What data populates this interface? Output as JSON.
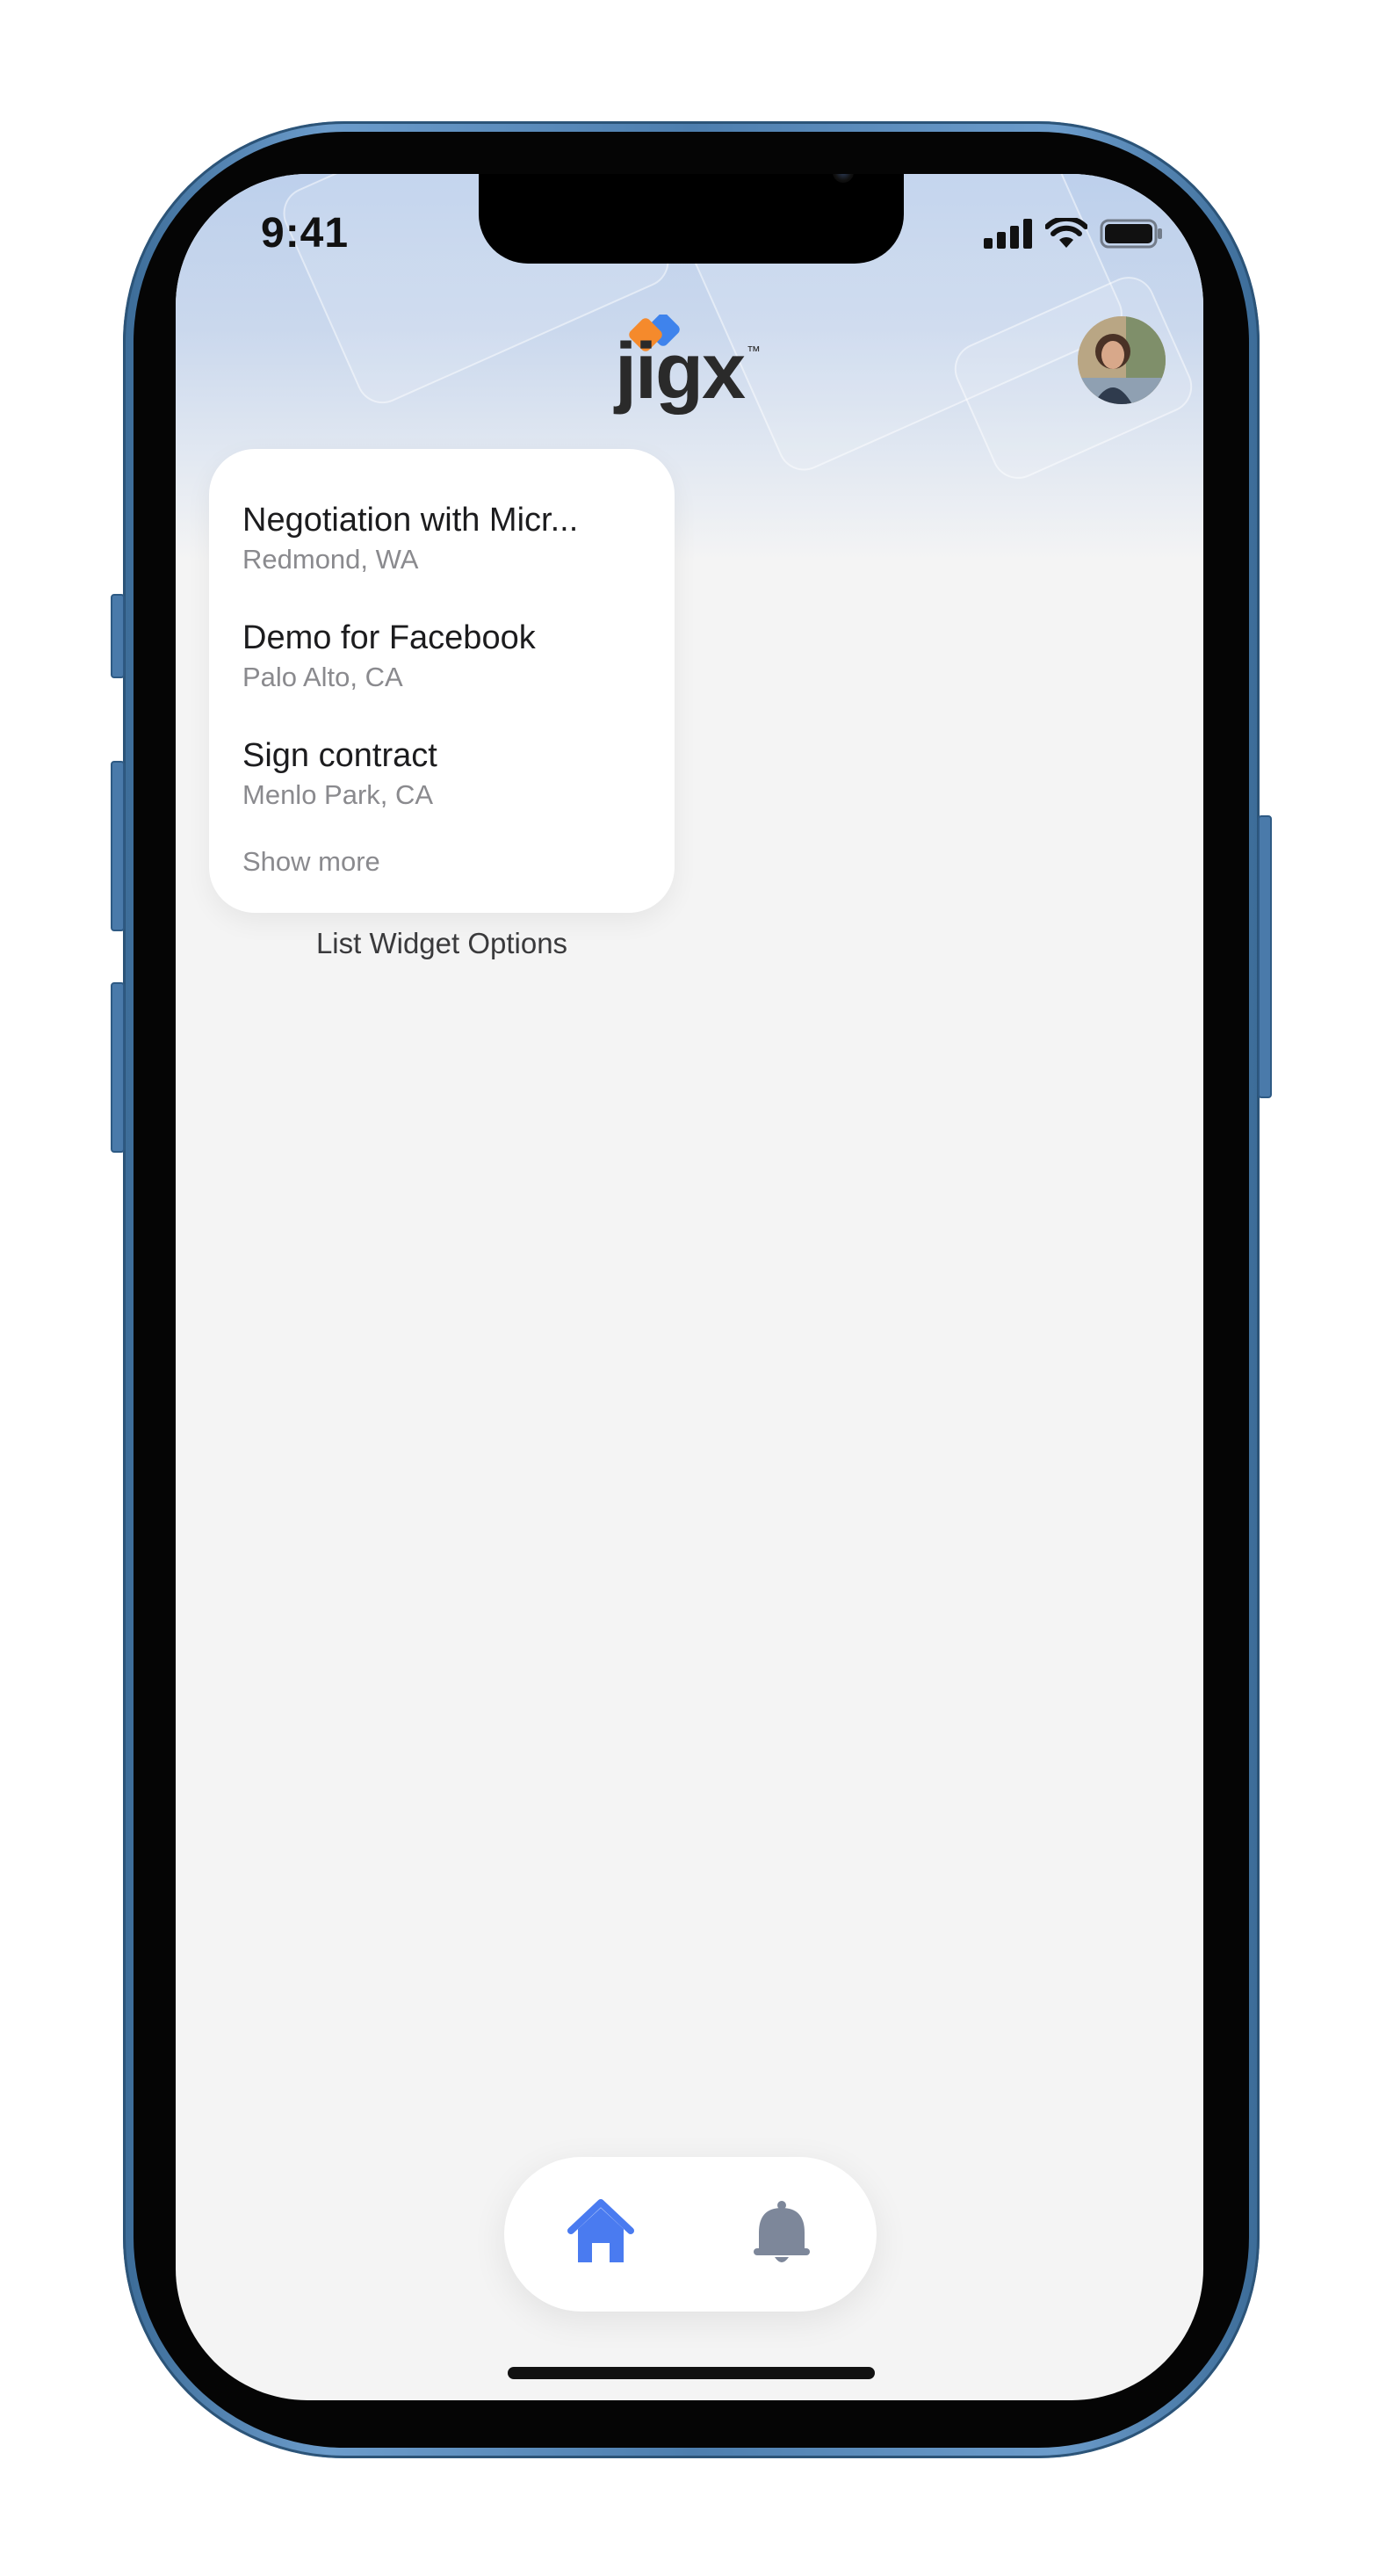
{
  "status_bar": {
    "time": "9:41"
  },
  "header": {
    "logo_text": "jigx",
    "logo_trademark": "™"
  },
  "list_widget": {
    "items": [
      {
        "title": "Negotiation with Micr...",
        "subtitle": "Redmond, WA"
      },
      {
        "title": "Demo for Facebook",
        "subtitle": "Palo Alto, CA"
      },
      {
        "title": "Sign contract",
        "subtitle": "Menlo Park, CA"
      }
    ],
    "show_more_label": "Show more",
    "caption": "List Widget Options"
  },
  "tab_bar": {
    "tabs": [
      {
        "icon": "home-icon",
        "active": true
      },
      {
        "icon": "bell-icon",
        "active": false
      }
    ]
  },
  "colors": {
    "accent": "#4a7bf0",
    "inactive_icon": "#7d879a",
    "logo_orange": "#f58a2c",
    "logo_blue": "#3f83ec",
    "phone_frame": "#4d7eae"
  }
}
